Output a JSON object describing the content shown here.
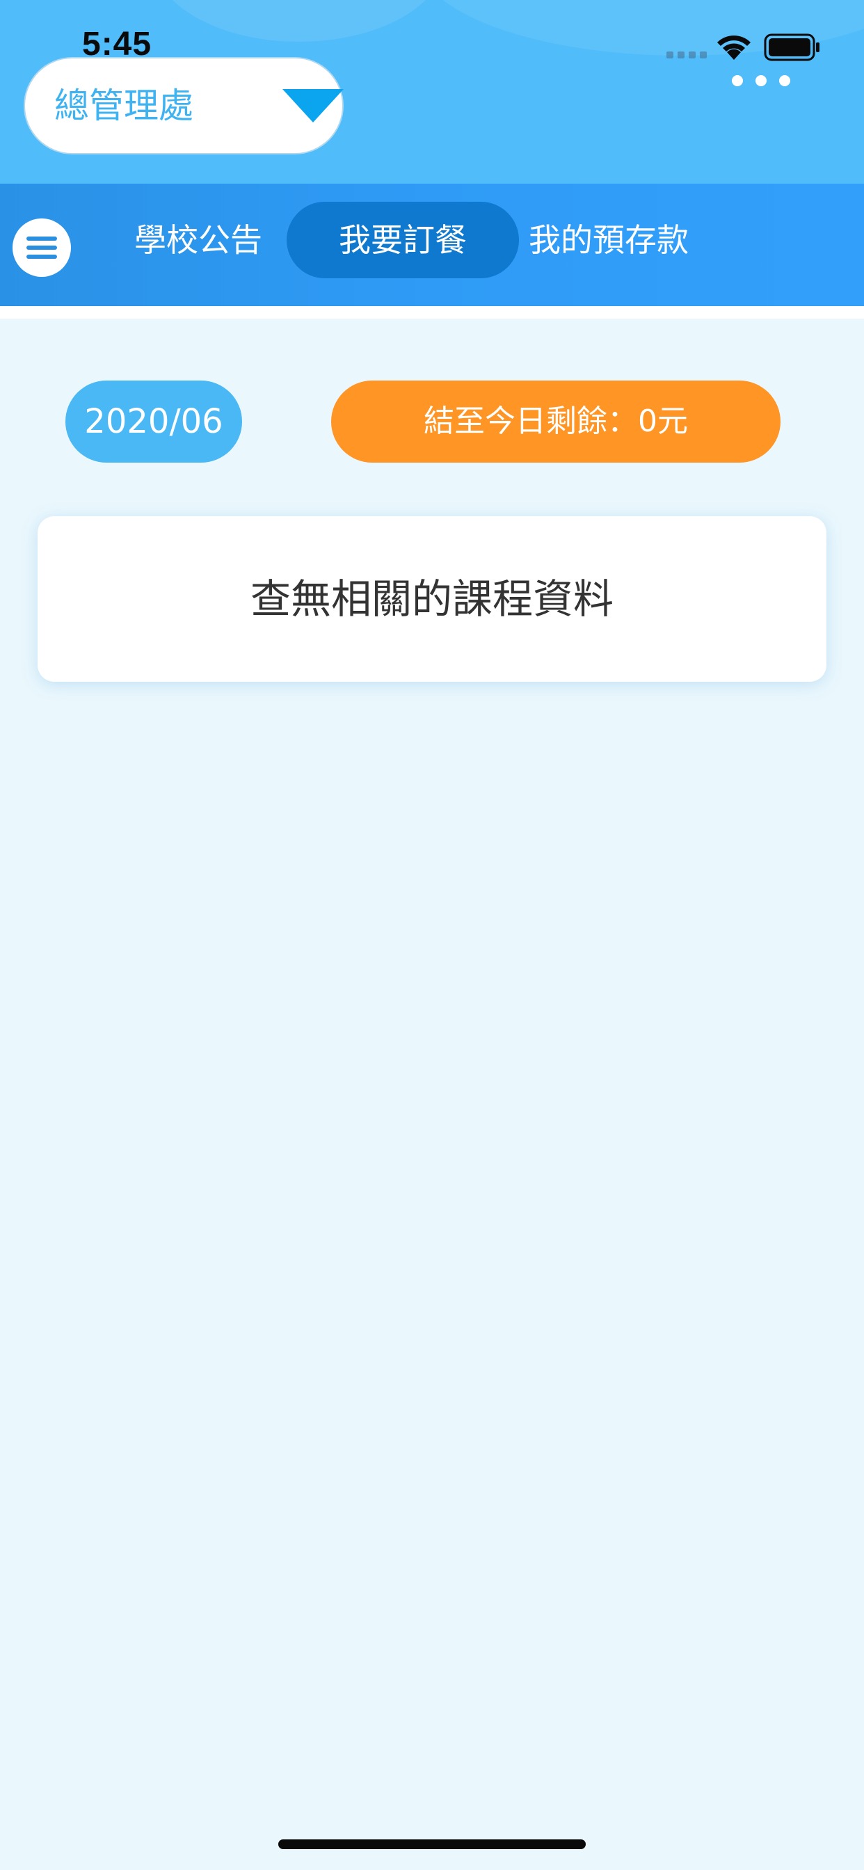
{
  "status_bar": {
    "time": "5:45"
  },
  "header": {
    "selector_label": "總管理處",
    "colors": {
      "background": "#50bcfa",
      "selector_text": "#3fb3f2",
      "chevron": "#0aa4ef"
    }
  },
  "nav": {
    "tabs": [
      {
        "label": "學校公告",
        "active": false
      },
      {
        "label": "我要訂餐",
        "active": true
      },
      {
        "label": "我的預存款",
        "active": false
      }
    ],
    "colors": {
      "background": "#2f9bf6",
      "active_tab": "#0f78cf"
    }
  },
  "summary": {
    "date": "2020/06",
    "balance_text": "結至今日剩餘：0元",
    "colors": {
      "date_pill": "#4ab8f5",
      "balance_pill": "#fe9524"
    }
  },
  "content": {
    "empty_message": "查無相關的課程資料"
  },
  "icons": {
    "menu": "hamburger-menu-icon",
    "more": "more-dots-icon",
    "wifi": "wifi-icon",
    "battery": "battery-icon",
    "dropdown": "chevron-down-icon"
  }
}
